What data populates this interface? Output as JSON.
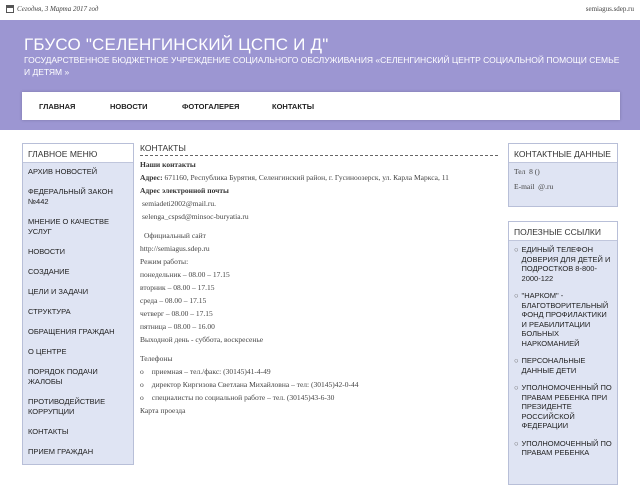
{
  "topbar": {
    "date": "Сегодня, 3 Марта 2017 год",
    "site": "semiagus.sdep.ru"
  },
  "header": {
    "title": "ГБУСО \"СЕЛЕНГИНСКИЙ ЦСПС И Д\"",
    "subtitle": "ГОСУДАРСТВЕННОЕ БЮДЖЕТНОЕ УЧРЕЖДЕНИЕ СОЦИАЛЬНОГО ОБСЛУЖИВАНИЯ «СЕЛЕНГИНСКИЙ ЦЕНТР СОЦИАЛЬНОЙ ПОМОЩИ СЕМЬЕ И ДЕТЯМ »",
    "nav": [
      "ГЛАВНАЯ",
      "НОВОСТИ",
      "ФОТОГАЛЕРЕЯ",
      "КОНТАКТЫ"
    ]
  },
  "left_menu": {
    "title": "ГЛАВНОЕ МЕНЮ",
    "items": [
      "АРХИВ НОВОСТЕЙ",
      "ФЕДЕРАЛЬНЫЙ ЗАКОН №442",
      "МНЕНИЕ О КАЧЕСТВЕ УСЛУГ",
      "НОВОСТИ",
      "СОЗДАНИЕ",
      "ЦЕЛИ И ЗАДАЧИ",
      "СТРУКТУРА",
      "ОБРАЩЕНИЯ ГРАЖДАН",
      "О ЦЕНТРЕ",
      "ПОРЯДОК ПОДАЧИ ЖАЛОБЫ",
      "ПРОТИВОДЕЙСТВИЕ КОРРУПЦИИ",
      "КОНТАКТЫ",
      "ПРИЕМ ГРАЖДАН"
    ]
  },
  "main": {
    "title": "КОНТАКТЫ",
    "contacts_heading": "Наши контакты",
    "address_label": "Адрес:",
    "address_value": "671160, Республика Бурятия, Селенгинский район, г. Гусиноозерск, ул. Карла Маркса, 11",
    "email_heading": "Адрес электронной почты",
    "email1": "semiadeti2002@mail.ru.",
    "email2": "selenga_cspsd@minsoc-buryatia.ru",
    "official_site_label": "Официальный сайт",
    "official_site_value": "http://semiagus.sdep.ru",
    "schedule_heading": "Режим работы:",
    "schedule": [
      "понедельник – 08.00 – 17.15",
      "вторник – 08.00 – 17.15",
      "среда – 08.00 – 17.15",
      "четверг – 08.00 – 17.15",
      "пятница – 08.00 – 16.00",
      "Выходной день - суббота, воскресенье"
    ],
    "phones_heading": "Телефоны",
    "phones": [
      "приемная – тел./факс: (30145)41-4-49",
      "директор Киргизова Светлана Михайловна – тел: (30145)42-0-44",
      "специалисты по социальной работе – тел. (30145)43-6-30"
    ],
    "map_label": "Карта проезда"
  },
  "right": {
    "contact_title": "КОНТАКТНЫЕ ДАННЫЕ",
    "tel_label": "Тел",
    "tel_value": "8 ()",
    "email_label": "E-mail",
    "email_value": "@.ru",
    "links_title": "ПОЛЕЗНЫЕ ССЫЛКИ",
    "links": [
      "ЕДИНЫЙ ТЕЛЕФОН ДОВЕРИЯ ДЛЯ ДЕТЕЙ И ПОДРОСТКОВ 8-800-2000-122",
      "\"НАРКОМ\" - БЛАГОТВОРИТЕЛЬНЫЙ ФОНД ПРОФИЛАКТИКИ И РЕАБИЛИТАЦИИ БОЛЬНЫХ НАРКОМАНИЕЙ",
      "ПЕРСОНАЛЬНЫЕ ДАННЫЕ ДЕТИ",
      "УПОЛНОМОЧЕННЫЙ ПО ПРАВАМ РЕБЕНКА ПРИ ПРЕЗИДЕНТЕ РОССИЙСКОЙ ФЕДЕРАЦИИ",
      "УПОЛНОМОЧЕННЫЙ ПО ПРАВАМ РЕБЕНКА"
    ]
  }
}
